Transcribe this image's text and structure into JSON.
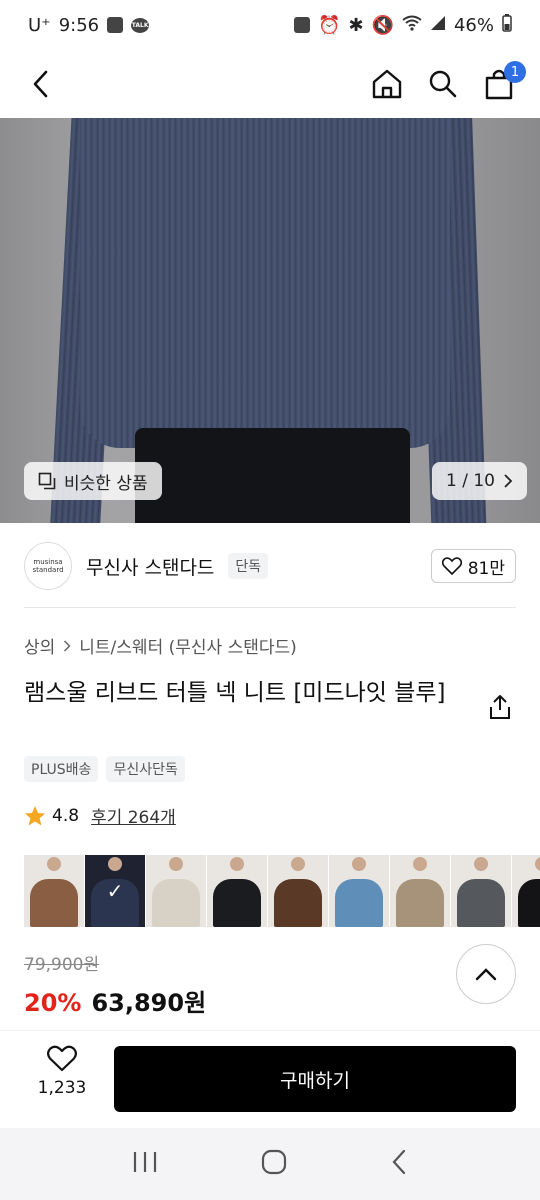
{
  "status_bar": {
    "carrier": "U⁺",
    "time": "9:56",
    "battery": "46%"
  },
  "nav": {
    "cart_count": "1"
  },
  "hero": {
    "similar_label": "비슷한 상품",
    "page_indicator": "1 / 10"
  },
  "brand": {
    "logo_line1": "musinsa",
    "logo_line2": "standard",
    "name": "무신사 스탠다드",
    "exclusive_tag": "단독",
    "like_count": "81만"
  },
  "breadcrumb": {
    "level1": "상의",
    "level2": "니트/스웨터 (무신사 스탠다드)"
  },
  "product": {
    "title": "램스울 리브드 터틀 넥 니트 [미드나잇 블루]"
  },
  "tags": [
    "PLUS배송",
    "무신사단독"
  ],
  "rating": {
    "score": "4.8",
    "review_label": "후기 264개"
  },
  "swatches": [
    {
      "color": "#8a5e43",
      "selected": false
    },
    {
      "color": "#2b3550",
      "selected": true
    },
    {
      "color": "#d7d2c5",
      "selected": false
    },
    {
      "color": "#1b1c1f",
      "selected": false
    },
    {
      "color": "#5a3a27",
      "selected": false
    },
    {
      "color": "#5f8fb8",
      "selected": false
    },
    {
      "color": "#a7937a",
      "selected": false
    },
    {
      "color": "#55585c",
      "selected": false
    },
    {
      "color": "#141416",
      "selected": false
    }
  ],
  "price": {
    "original": "79,900원",
    "discount": "20%",
    "sale": "63,890원"
  },
  "bottom": {
    "wish_count": "1,233",
    "buy_label": "구매하기"
  },
  "colors": {
    "accent_red": "#e2231a",
    "badge_blue": "#2f6fe4"
  }
}
